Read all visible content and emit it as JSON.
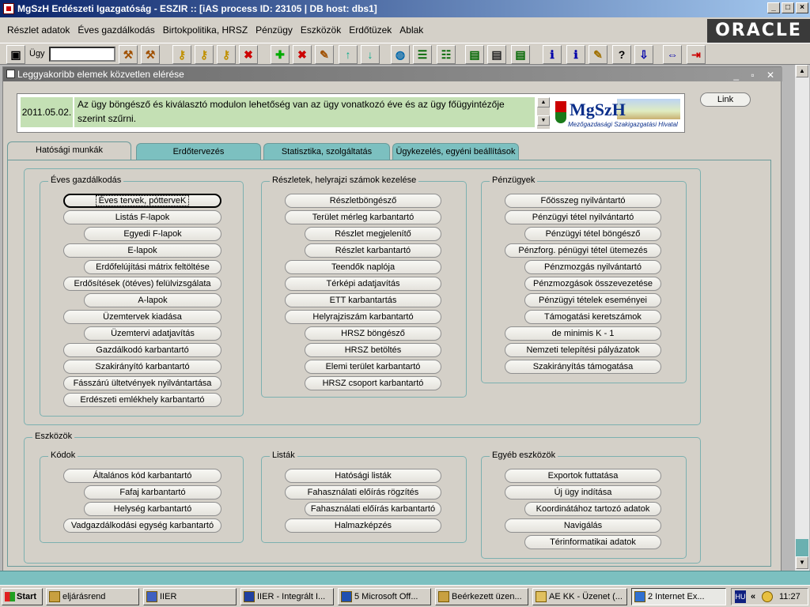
{
  "window": {
    "title": "MgSzH Erdészeti Igazgatóság - ESZIR :: [iAS process ID: 23105 | DB host: dbs1]"
  },
  "menu": [
    "Részlet adatok",
    "Éves gazdálkodás",
    "Birtokpolitika, HRSZ",
    "Pénzügy",
    "Eszközök",
    "Erdőtüzek",
    "Ablak"
  ],
  "brand": "ORACLE",
  "toolbar": {
    "ugy_label": "Ügy",
    "ugy_value": ""
  },
  "form": {
    "title": "Leggyakoribb elemek közvetlen elérése"
  },
  "message": {
    "date": "2011.05.02.",
    "text": "Az ügy böngésző és kiválasztó modulon lehetőség van az ügy vonatkozó éve és az ügy főügyintézője szerint szűrni."
  },
  "logo": {
    "name": "MgSzH",
    "subtitle": "Mezőgazdasági Szakigazgatási Hivatal"
  },
  "link_button": "Link",
  "tabs": [
    "Hatósági munkák",
    "Erdőtervezés",
    "Statisztika, szolgáltatás",
    "Ügykezelés, egyéni beállítások"
  ],
  "sections": {
    "eves": {
      "title": "Éves gazdálkodás",
      "buttons": [
        "Éves tervek, pótterveK",
        "Listás F-lapok",
        "Egyedi F-lapok",
        "E-lapok",
        "Erdőfelújítási mátrix feltöltése",
        "Erdősítések (ötéves) felülvizsgálata",
        "A-lapok",
        "Üzemtervek kiadása",
        "Üzemtervi adatjavítás",
        "Gazdálkodó karbantartó",
        "Szakirányító karbantartó",
        "Fásszárú ültetvények nyilvántartása",
        "Erdészeti emlékhely karbantartó"
      ]
    },
    "reszletek": {
      "title": "Részletek, helyrajzi számok kezelése",
      "buttons": [
        "Részletböngésző",
        "Terület mérleg karbantartó",
        "Részlet megjelenítő",
        "Részlet karbantartó",
        "Teendők naplója",
        "Térképi adatjavítás",
        "ETT karbantartás",
        "Helyrajziszám karbantartó",
        "HRSZ böngésző",
        "HRSZ betöltés",
        "Elemi terület karbantartó",
        "HRSZ csoport karbantartó"
      ]
    },
    "penzugyek": {
      "title": "Pénzügyek",
      "buttons": [
        "Főösszeg nyilvántartó",
        "Pénzügyi tétel nyilvántartó",
        "Pénzügyi tétel böngésző",
        "Pénzforg. pénügyi tétel ütemezés",
        "Pénzmozgás nyilvántartó",
        "Pénzmozgások összevezetése",
        "Pénzügyi tételek eseményei",
        "Támogatási keretszámok",
        "de minimis K - 1",
        "Nemzeti telepítési pályázatok",
        "Szakirányítás támogatása"
      ]
    },
    "eszkozok": {
      "title": "Eszközök"
    },
    "kodok": {
      "title": "Kódok",
      "buttons": [
        "Általános kód karbantartó",
        "Fafaj karbantartó",
        "Helység karbantartó",
        "Vadgazdálkodási egység karbantartó"
      ]
    },
    "listak": {
      "title": "Listák",
      "buttons": [
        "Hatósági listák",
        "Fahasználati előírás rögzítés",
        "Fahasználati előírás karbantartó",
        "Halmazképzés"
      ]
    },
    "egyeb": {
      "title": "Egyéb eszközök",
      "buttons": [
        "Exportok futtatása",
        "Új ügy indítása",
        "Koordinátához tartozó adatok",
        "Navigálás",
        "Térinformatikai adatok"
      ]
    }
  },
  "taskbar": {
    "start": "Start",
    "items": [
      "eljárásrend",
      "IIER",
      "IIER - Integrált I...",
      "5 Microsoft Off...",
      "Beérkezett üzen...",
      "AE KK - Üzenet (...",
      "2 Internet Ex..."
    ],
    "lang": "HU",
    "clock": "11:27"
  },
  "colors": {
    "title_bar": "#0a246a",
    "tab": "#7cc0c0",
    "message_bg": "#c4e0b4",
    "frame_border": "#7cb0b0"
  }
}
